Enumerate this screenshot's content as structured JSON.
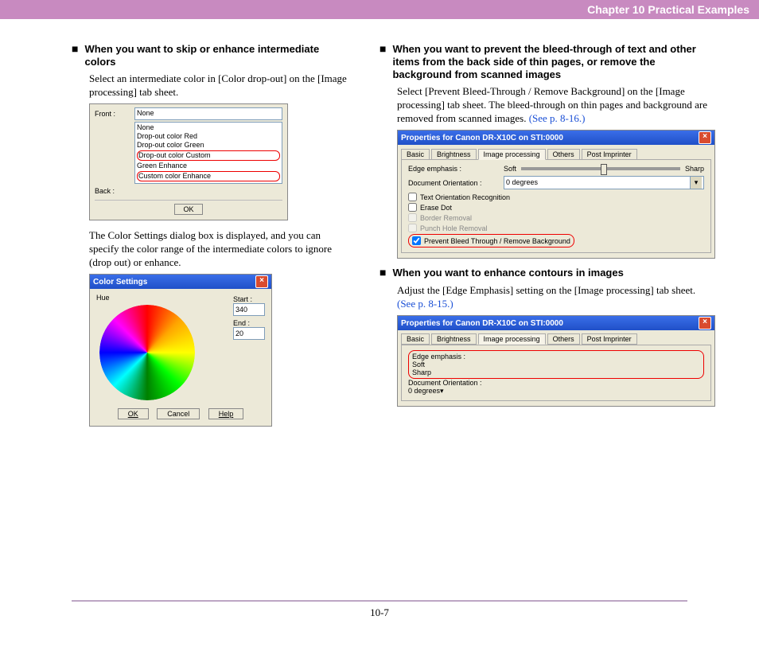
{
  "header": {
    "title": "Chapter 10   Practical Examples"
  },
  "left": {
    "section1": {
      "heading": "When you want to skip or enhance intermediate colors",
      "body1": "Select an intermediate color in [Color drop-out] on the [Image processing] tab sheet.",
      "body2": "The Color Settings dialog box is displayed, and you can specify the color range of the intermediate colors to ignore (drop out) or enhance."
    },
    "fig1": {
      "front_label": "Front :",
      "back_label": "Back :",
      "selected": "None",
      "options": [
        "None",
        "Drop-out color Red",
        "Drop-out color Green"
      ],
      "red1": "Drop-out color Custom",
      "mid": "Green Enhance",
      "red2": "Custom color Enhance",
      "ok": "OK"
    },
    "fig2": {
      "title": "Color Settings",
      "hue": "Hue",
      "start_label": "Start :",
      "start_val": "340",
      "end_label": "End :",
      "end_val": "20",
      "ok": "OK",
      "cancel": "Cancel",
      "help": "Help"
    }
  },
  "right": {
    "section1": {
      "heading": "When you want to prevent the bleed-through of text and other items from the back side of thin pages, or remove the background from scanned images",
      "body": "Select [Prevent Bleed-Through / Remove Background] on the [Image processing] tab sheet. The bleed-through on thin pages and background are removed from scanned images. ",
      "link": "(See p. 8-16.)"
    },
    "fig3": {
      "title": "Properties for Canon DR-X10C on STI:0000",
      "tabs": [
        "Basic",
        "Brightness",
        "Image processing",
        "Others",
        "Post Imprinter"
      ],
      "edge_label": "Edge emphasis :",
      "soft": "Soft",
      "sharp": "Sharp",
      "doc_orient_label": "Document Orientation :",
      "doc_orient_val": "0 degrees",
      "cb1": "Text Orientation Recognition",
      "cb2": "Erase Dot",
      "cb3": "Border Removal",
      "cb4": "Punch Hole Removal",
      "cb5": "Prevent Bleed Through / Remove Background"
    },
    "section2": {
      "heading": "When you want to enhance contours in images",
      "body": "Adjust the [Edge Emphasis] setting on the [Image processing] tab sheet. ",
      "link": "(See p. 8-15.)"
    },
    "fig4": {
      "title": "Properties for Canon DR-X10C on STI:0000",
      "tabs": [
        "Basic",
        "Brightness",
        "Image processing",
        "Others",
        "Post Imprinter"
      ],
      "edge_label": "Edge emphasis :",
      "soft": "Soft",
      "sharp": "Sharp",
      "doc_orient_label": "Document Orientation :",
      "doc_orient_val": "0 degrees"
    }
  },
  "footer": {
    "page": "10-7"
  }
}
